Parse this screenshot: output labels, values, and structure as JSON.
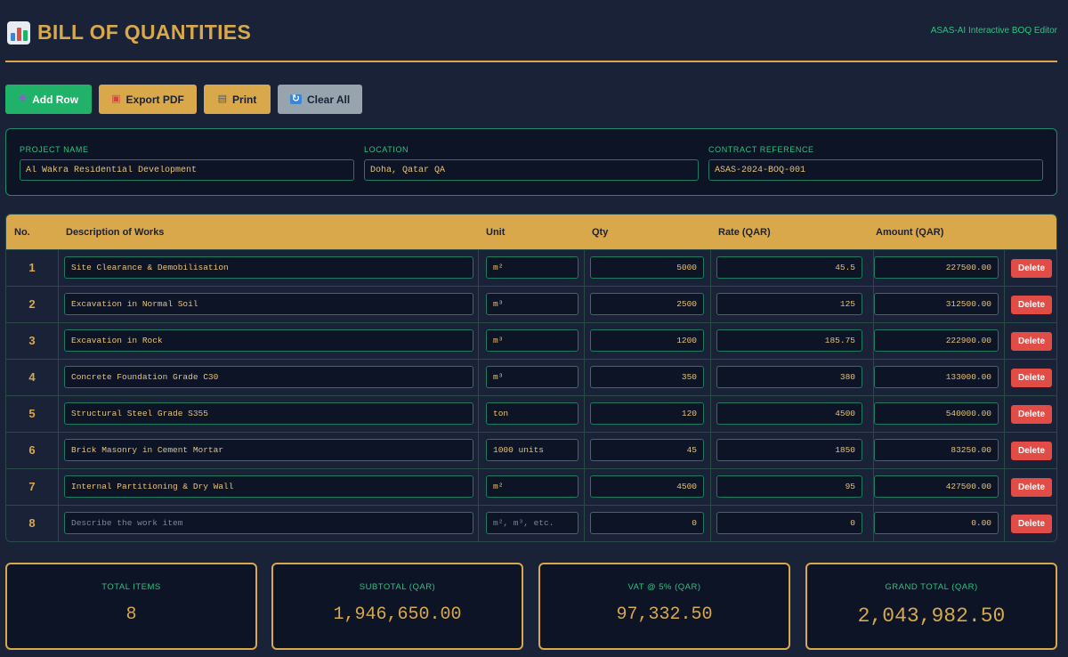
{
  "header": {
    "title": "BILL OF QUANTITIES",
    "subtitle": "ASAS-AI Interactive BOQ Editor",
    "icon": "bar-chart-icon"
  },
  "toolbar": {
    "add_row": "Add Row",
    "export_pdf": "Export PDF",
    "print": "Print",
    "clear_all": "Clear All"
  },
  "project": {
    "name_label": "PROJECT NAME",
    "name_value": "Al Wakra Residential Development",
    "location_label": "LOCATION",
    "location_value": "Doha, Qatar QA",
    "contract_label": "CONTRACT REFERENCE",
    "contract_value": "ASAS-2024-BOQ-001"
  },
  "table": {
    "headers": {
      "no": "No.",
      "description": "Description of Works",
      "unit": "Unit",
      "qty": "Qty",
      "rate": "Rate (QAR)",
      "amount": "Amount (QAR)"
    },
    "delete_label": "Delete",
    "rows": [
      {
        "no": "1",
        "description": "Site Clearance & Demobilisation",
        "unit": "m²",
        "qty": "5000",
        "rate": "45.5",
        "amount": "227500.00"
      },
      {
        "no": "2",
        "description": "Excavation in Normal Soil",
        "unit": "m³",
        "qty": "2500",
        "rate": "125",
        "amount": "312500.00"
      },
      {
        "no": "3",
        "description": "Excavation in Rock",
        "unit": "m³",
        "qty": "1200",
        "rate": "185.75",
        "amount": "222900.00"
      },
      {
        "no": "4",
        "description": "Concrete Foundation Grade C30",
        "unit": "m³",
        "qty": "350",
        "rate": "380",
        "amount": "133000.00"
      },
      {
        "no": "5",
        "description": "Structural Steel Grade S355",
        "unit": "ton",
        "qty": "120",
        "rate": "4500",
        "amount": "540000.00"
      },
      {
        "no": "6",
        "description": "Brick Masonry in Cement Mortar",
        "unit": "1000 units",
        "qty": "45",
        "rate": "1850",
        "amount": "83250.00"
      },
      {
        "no": "7",
        "description": "Internal Partitioning & Dry Wall",
        "unit": "m²",
        "qty": "4500",
        "rate": "95",
        "amount": "427500.00"
      },
      {
        "no": "8",
        "description": "",
        "unit": "",
        "qty": "0",
        "rate": "0",
        "amount": "0.00"
      }
    ],
    "placeholders": {
      "description": "Describe the work item",
      "unit": "m², m³, etc."
    }
  },
  "summary": {
    "total_items_label": "TOTAL ITEMS",
    "total_items_value": "8",
    "subtotal_label": "SUBTOTAL (QAR)",
    "subtotal_value": "1,946,650.00",
    "vat_label": "VAT @ 5% (QAR)",
    "vat_value": "97,332.50",
    "grand_total_label": "GRAND TOTAL (QAR)",
    "grand_total_value": "2,043,982.50"
  },
  "colors": {
    "background": "#1a2238",
    "accent_gold": "#d8a84a",
    "accent_green": "#2ec27e",
    "delete_red": "#e14c47"
  }
}
